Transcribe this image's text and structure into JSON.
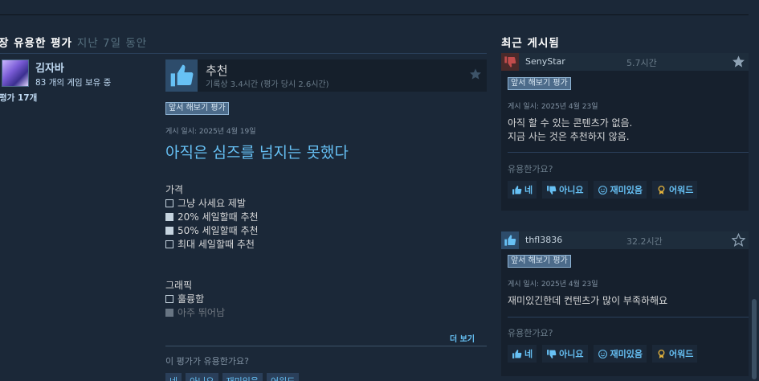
{
  "most_helpful": {
    "title": "가장 유용한 평가",
    "title_visible": "장 유용한 평가",
    "period": "지난 7일 동안",
    "author": {
      "name": "김자바",
      "games_owned": "83 개의 게임 보유 중",
      "reviews": "평가 17개"
    },
    "review": {
      "verdict": "추천",
      "hours": "기록상 3.4시간 (평가 당시 2.6시간)",
      "early_access": "앞서 해보기 평가",
      "posted": "게시 일시: 2025년 4월 19일",
      "headline": "아직은 심즈를 넘지는 못했다",
      "section_price": "가격",
      "price_options": [
        {
          "label": "그냥 사세요 제발",
          "checked": false
        },
        {
          "label": "20% 세일할때 추천",
          "checked": true
        },
        {
          "label": "50% 세일할때 추천",
          "checked": true
        },
        {
          "label": "최대 세일할때 추천",
          "checked": false
        }
      ],
      "section_graphics": "그래픽",
      "graphics_options": [
        {
          "label": "훌륭함",
          "checked": false
        },
        {
          "label": "아주 뛰어남",
          "checked": true
        }
      ],
      "read_more": "더 보기",
      "helpful_question": "이 평가가 유용한가요?",
      "buttons": [
        "네",
        "아니요",
        "재미있음",
        "어워드"
      ]
    }
  },
  "recent": {
    "title": "최근 게시됨",
    "posts": [
      {
        "user": "SenyStar",
        "time": "5.7시간",
        "recommended": false,
        "early_access": "앞서 해보기 평가",
        "posted": "게시 일시: 2025년 4월 23일",
        "text": [
          "아직 할 수 있는 콘텐츠가 없음.",
          "지금 사는 것은 추천하지 않음."
        ],
        "helpful_question": "유용한가요?",
        "buttons": [
          "네",
          "아니요",
          "재미있음",
          "어워드"
        ]
      },
      {
        "user": "thfl3836",
        "time": "32.2시간",
        "recommended": true,
        "early_access": "앞서 해보기 평가",
        "posted": "게시 일시: 2025년 4월 23일",
        "text": [
          "재미있긴한데 컨텐츠가 많이 부족하해요"
        ],
        "helpful_question": "유용한가요?",
        "buttons": [
          "네",
          "아니요",
          "재미있음",
          "어워드"
        ]
      }
    ]
  },
  "colors": {
    "background": "#1b2838",
    "link_blue": "#66c0f4",
    "thumb_up_blue": "#67c1f5",
    "thumb_down_red": "#c24c4c",
    "award_gold": "#e3b23c"
  }
}
